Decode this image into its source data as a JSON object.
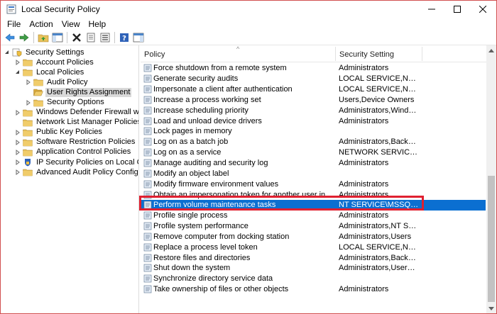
{
  "window": {
    "title": "Local Security Policy"
  },
  "menu": [
    "File",
    "Action",
    "View",
    "Help"
  ],
  "tree": [
    {
      "label": "Security Settings",
      "indent": 0,
      "arrow": "expanded",
      "icon": "shield"
    },
    {
      "label": "Account Policies",
      "indent": 1,
      "arrow": "collapsed",
      "icon": "folder"
    },
    {
      "label": "Local Policies",
      "indent": 1,
      "arrow": "expanded",
      "icon": "folder"
    },
    {
      "label": "Audit Policy",
      "indent": 2,
      "arrow": "collapsed",
      "icon": "folder"
    },
    {
      "label": "User Rights Assignment",
      "indent": 2,
      "arrow": "none",
      "icon": "folder-open",
      "selected": true
    },
    {
      "label": "Security Options",
      "indent": 2,
      "arrow": "collapsed",
      "icon": "folder"
    },
    {
      "label": "Windows Defender Firewall with Adva",
      "indent": 1,
      "arrow": "collapsed",
      "icon": "folder"
    },
    {
      "label": "Network List Manager Policies",
      "indent": 1,
      "arrow": "none",
      "icon": "folder"
    },
    {
      "label": "Public Key Policies",
      "indent": 1,
      "arrow": "collapsed",
      "icon": "folder"
    },
    {
      "label": "Software Restriction Policies",
      "indent": 1,
      "arrow": "collapsed",
      "icon": "folder"
    },
    {
      "label": "Application Control Policies",
      "indent": 1,
      "arrow": "collapsed",
      "icon": "folder"
    },
    {
      "label": "IP Security Policies on Local Compute",
      "indent": 1,
      "arrow": "collapsed",
      "icon": "shield-blue"
    },
    {
      "label": "Advanced Audit Policy Configuration",
      "indent": 1,
      "arrow": "collapsed",
      "icon": "folder"
    }
  ],
  "columns": {
    "policy": "Policy",
    "setting": "Security Setting"
  },
  "rows": [
    {
      "policy": "Force shutdown from a remote system",
      "setting": "Administrators"
    },
    {
      "policy": "Generate security audits",
      "setting": "LOCAL SERVICE,NETWO..."
    },
    {
      "policy": "Impersonate a client after authentication",
      "setting": "LOCAL SERVICE,NETWO..."
    },
    {
      "policy": "Increase a process working set",
      "setting": "Users,Device Owners"
    },
    {
      "policy": "Increase scheduling priority",
      "setting": "Administrators,Window ..."
    },
    {
      "policy": "Load and unload device drivers",
      "setting": "Administrators"
    },
    {
      "policy": "Lock pages in memory",
      "setting": ""
    },
    {
      "policy": "Log on as a batch job",
      "setting": "Administrators,Backup ..."
    },
    {
      "policy": "Log on as a service",
      "setting": "NETWORK SERVICE,SQL..."
    },
    {
      "policy": "Manage auditing and security log",
      "setting": "Administrators"
    },
    {
      "policy": "Modify an object label",
      "setting": ""
    },
    {
      "policy": "Modify firmware environment values",
      "setting": "Administrators"
    },
    {
      "policy": "Obtain an impersonation token for another user in the same...",
      "setting": "Administrators"
    },
    {
      "policy": "Perform volume maintenance tasks",
      "setting": "NT SERVICE\\MSSQL$DB...",
      "selected": true
    },
    {
      "policy": "Profile single process",
      "setting": "Administrators"
    },
    {
      "policy": "Profile system performance",
      "setting": "Administrators,NT SERVI..."
    },
    {
      "policy": "Remove computer from docking station",
      "setting": "Administrators,Users"
    },
    {
      "policy": "Replace a process level token",
      "setting": "LOCAL SERVICE,NETWO..."
    },
    {
      "policy": "Restore files and directories",
      "setting": "Administrators,Backup ..."
    },
    {
      "policy": "Shut down the system",
      "setting": "Administrators,Users,Ba..."
    },
    {
      "policy": "Synchronize directory service data",
      "setting": ""
    },
    {
      "policy": "Take ownership of files or other objects",
      "setting": "Administrators"
    }
  ],
  "colors": {
    "selection": "#0b6fd1",
    "annotation": "#e02030",
    "folder": "#e8c15a"
  }
}
